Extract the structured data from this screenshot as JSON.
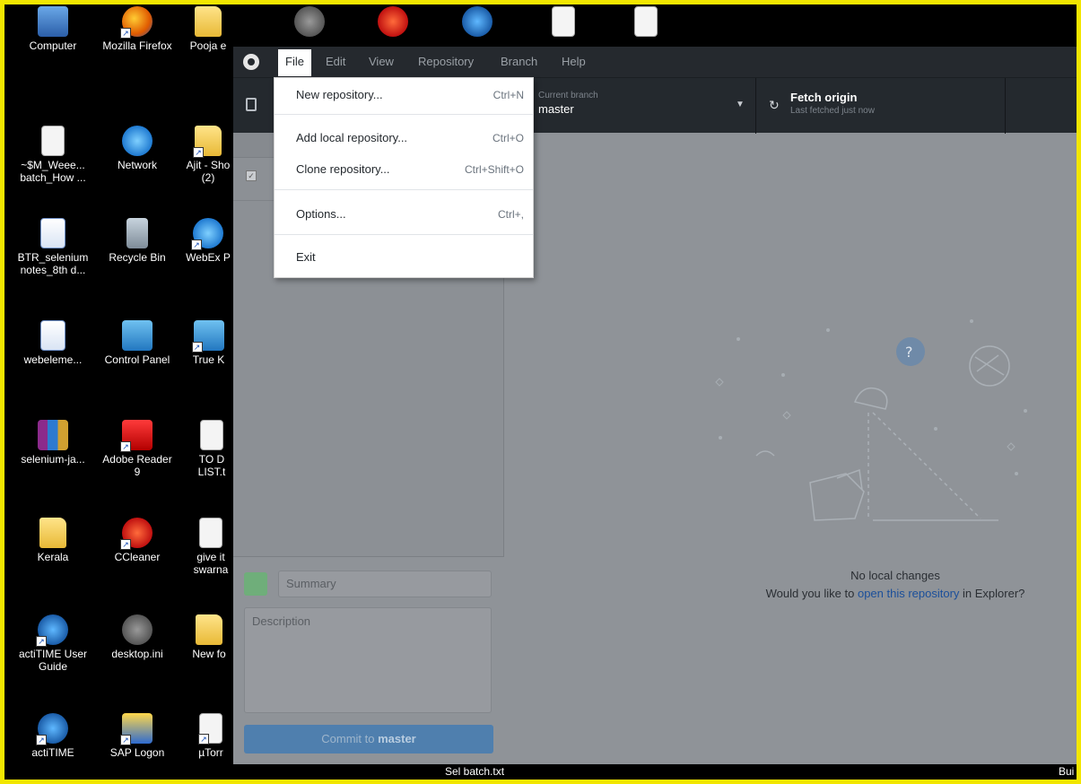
{
  "desktop": {
    "icons": [
      {
        "label": "Computer",
        "icon": "computer-icon"
      },
      {
        "label": "Mozilla Firefox",
        "icon": "firefox-icon"
      },
      {
        "label": "Pooja e",
        "icon": "folder-icon"
      },
      {
        "label": "~$M_Weee... batch_How ...",
        "icon": "document-icon"
      },
      {
        "label": "Network",
        "icon": "network-icon"
      },
      {
        "label": "Ajit - Sho (2)",
        "icon": "folder-icon"
      },
      {
        "label": "BTR_selenium notes_8th d...",
        "icon": "word-document-icon"
      },
      {
        "label": "Recycle Bin",
        "icon": "recycle-bin-icon"
      },
      {
        "label": "WebEx P",
        "icon": "webex-icon"
      },
      {
        "label": "webeleme...",
        "icon": "word-document-icon"
      },
      {
        "label": "Control Panel",
        "icon": "control-panel-icon"
      },
      {
        "label": "True K",
        "icon": "truekey-icon"
      },
      {
        "label": "selenium-ja...",
        "icon": "winrar-icon"
      },
      {
        "label": "Adobe Reader 9",
        "icon": "adobe-reader-icon"
      },
      {
        "label": "TO D LIST.t",
        "icon": "text-file-icon"
      },
      {
        "label": "Kerala",
        "icon": "folder-icon"
      },
      {
        "label": "CCleaner",
        "icon": "ccleaner-icon"
      },
      {
        "label": "give it swarna",
        "icon": "text-file-icon"
      },
      {
        "label": "actiTIME User Guide",
        "icon": "ie-shortcut-icon"
      },
      {
        "label": "desktop.ini",
        "icon": "settings-file-icon"
      },
      {
        "label": "New fo",
        "icon": "folder-icon"
      },
      {
        "label": "actiTIME",
        "icon": "ie-shortcut-icon"
      },
      {
        "label": "SAP Logon",
        "icon": "sap-icon"
      },
      {
        "label": "µTorr",
        "icon": "utorrent-icon"
      }
    ]
  },
  "window": {
    "menu": [
      "File",
      "Edit",
      "View",
      "Repository",
      "Branch",
      "Help"
    ],
    "toolbar": {
      "branch_caption": "Current branch",
      "branch_value": "master",
      "fetch_title": "Fetch origin",
      "fetch_subtitle": "Last fetched just now"
    },
    "file_menu": [
      {
        "label": "New repository...",
        "shortcut": "Ctrl+N"
      },
      {
        "label": "Add local repository...",
        "shortcut": "Ctrl+O"
      },
      {
        "label": "Clone repository...",
        "shortcut": "Ctrl+Shift+O"
      },
      {
        "label": "Options...",
        "shortcut": "Ctrl+,"
      },
      {
        "label": "Exit",
        "shortcut": ""
      }
    ],
    "commit": {
      "summary_placeholder": "Summary",
      "description_placeholder": "Description",
      "button_prefix": "Commit to ",
      "button_branch": "master"
    },
    "empty_state": {
      "title": "No local changes",
      "prompt_before": "Would you like to ",
      "prompt_link": "open this repository",
      "prompt_after": " in Explorer?"
    }
  },
  "taskbar": {
    "left_text": "Sel batch.txt",
    "right_text": "Bui"
  }
}
